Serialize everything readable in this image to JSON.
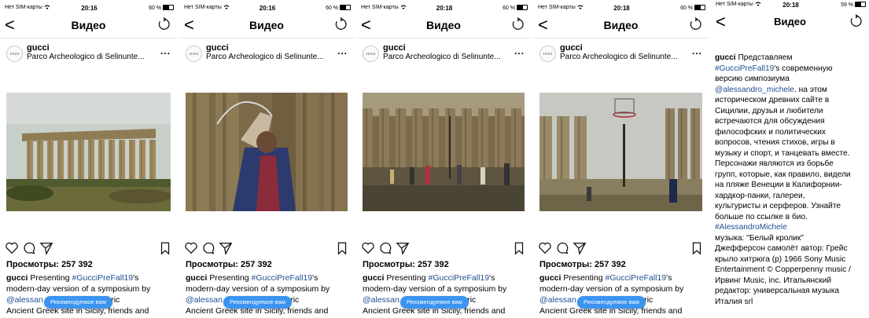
{
  "common": {
    "carrier": "Нет SIM-карты",
    "back_symbol": "<",
    "nav_title": "Видео",
    "username": "gucci",
    "location": "Parco Archeologico di Selinunte...",
    "more_symbol": "...",
    "views": "Просмотры: 257 392",
    "caption_user": "gucci",
    "caption_text": " Presenting ",
    "caption_tag": "#GucciPreFall19",
    "caption_line1_tail": "'s",
    "caption_line2": "modern-day version of a symposium by",
    "caption_line3_head": "@alessan",
    "caption_line3_tail": "istoric",
    "caption_line4": "Ancient Greek site in Sicily, friends and",
    "pill_label": "Рекомендуемое вам"
  },
  "screens": [
    {
      "time": "20:16",
      "battery": "60 %",
      "battery_level": 0.6
    },
    {
      "time": "20:16",
      "battery": "60 %",
      "battery_level": 0.6
    },
    {
      "time": "20:18",
      "battery": "60 %",
      "battery_level": 0.6
    },
    {
      "time": "20:18",
      "battery": "60 %",
      "battery_level": 0.6
    },
    {
      "time": "20:18",
      "battery": "59 %",
      "battery_level": 0.59
    }
  ],
  "full_caption": {
    "user": "gucci",
    "line01": "Представляем",
    "tag1": "#GucciPreFall19",
    "line02_tail": "'s современную",
    "line03": "версию симпозиума",
    "mention": "@alessandro_michele",
    "line04_tail": ". на этом",
    "line05": "историческом древних сайте в",
    "line06": "Сицилии, друзья и любители",
    "line07": "встречаются для обсуждения",
    "line08": "философских и политических",
    "line09": "вопросов, чтения стихов, игры в",
    "line10": "музыку и спорт, и танцевать вместе.",
    "line11": "Персонажи являются из борьбе",
    "line12": "групп, которые, как правило, видели",
    "line13": "на пляже Венеции в Калифорнии-",
    "line14": "хардкор-панки, галереи,",
    "line15": "культуристы и серферов. Узнайте",
    "line16": "больше по ссылке в био.",
    "tag2": "#AlessandroMichele",
    "line18": "музыка: \"Белый кролик\"",
    "line19": "Джефферсон самолёт автор: Грейс",
    "line20": "крыло хитрюга (р) 1966 Sony Music",
    "line21": "Entertainment © Copperpenny music /",
    "line22": "Ирвинг Music, inc. Итальянский",
    "line23": "редактор: универсальная музыка",
    "line24": "Италия srl"
  },
  "colors": {
    "link": "#1f4e8f",
    "pill": "#3b94f0"
  },
  "icons": [
    "wifi-icon",
    "back-chevron-icon",
    "refresh-icon",
    "more-icon",
    "heart-icon",
    "comment-icon",
    "share-icon",
    "bookmark-icon",
    "battery-icon"
  ]
}
